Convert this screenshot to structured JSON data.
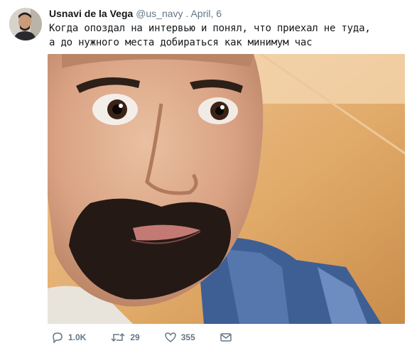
{
  "tweet": {
    "author_name": "Usnavi de la Vega",
    "handle": "@us_navy",
    "separator": ".",
    "date": "April, 6",
    "text_line1": "Когда опоздал на интервью и понял, что приехал не туда,",
    "text_line2": "а до нужного места добираться как минимум час"
  },
  "actions": {
    "reply_count": "1.0K",
    "retweet_count": "29",
    "like_count": "355"
  },
  "icons": {
    "reply": "reply-icon",
    "retweet": "retweet-icon",
    "like": "heart-icon",
    "message": "direct-message-icon"
  }
}
